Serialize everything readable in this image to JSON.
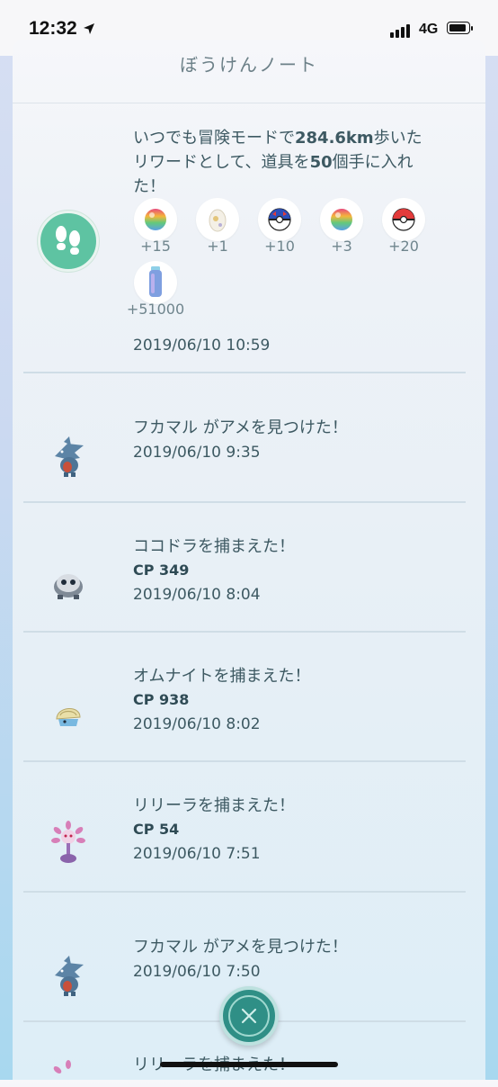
{
  "status_bar": {
    "time": "12:32",
    "network": "4G"
  },
  "header": {
    "title": "ぼうけんノート"
  },
  "journal": {
    "reward_entry": {
      "line1_prefix": "いつでも冒険モードで",
      "line1_bold": "284.6km",
      "line1_suffix": "歩いた",
      "line2_prefix": "リワードとして、道具を",
      "line2_bold": "50",
      "line2_suffix": "個手に入れ",
      "line3": "た！",
      "items": [
        {
          "icon": "rainbow-candy-icon",
          "qty": "+15"
        },
        {
          "icon": "egg-icon",
          "qty": "+1"
        },
        {
          "icon": "great-ball-icon",
          "qty": "+10"
        },
        {
          "icon": "rainbow-candy-icon",
          "qty": "+3"
        },
        {
          "icon": "poke-ball-icon",
          "qty": "+20"
        },
        {
          "icon": "stardust-icon",
          "qty": "+51000"
        }
      ],
      "date": "2019/06/10 10:59"
    },
    "entries": [
      {
        "message": "フカマル がアメを見つけた！",
        "cp": "",
        "date": "2019/06/10 9:35",
        "icon": "gible-icon"
      },
      {
        "message": "ココドラを捕まえた！",
        "cp": "CP 349",
        "date": "2019/06/10 8:04",
        "icon": "aron-icon"
      },
      {
        "message": "オムナイトを捕まえた！",
        "cp": "CP 938",
        "date": "2019/06/10 8:02",
        "icon": "omanyte-icon"
      },
      {
        "message": "リリーラを捕まえた！",
        "cp": "CP 54",
        "date": "2019/06/10 7:51",
        "icon": "lileep-icon"
      },
      {
        "message": "フカマル がアメを見つけた！",
        "cp": "",
        "date": "2019/06/10 7:50",
        "icon": "gible-icon"
      },
      {
        "message": "リリーラを捕まえた！",
        "cp": "",
        "date": "",
        "icon": "lileep-icon"
      }
    ]
  },
  "colors": {
    "accent": "#5ec3a2",
    "close_button": "#2f8f86"
  }
}
